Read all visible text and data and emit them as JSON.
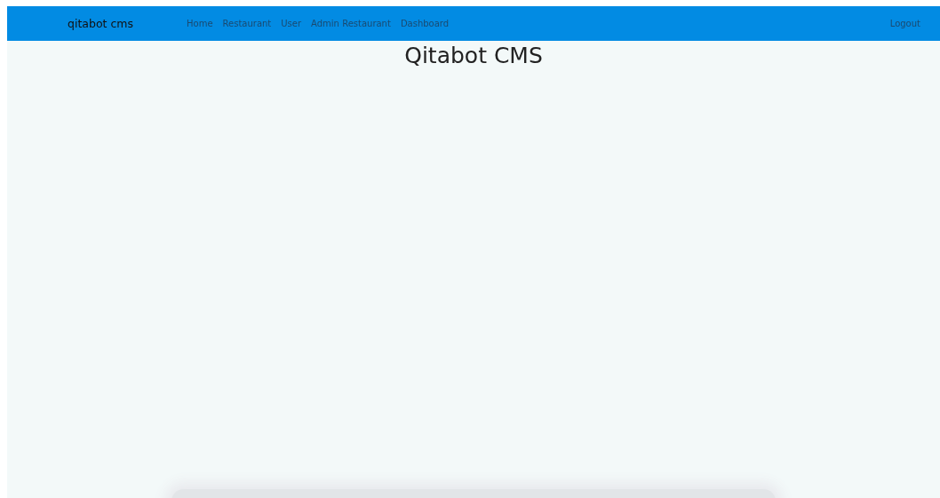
{
  "navbar": {
    "brand": "qitabot cms",
    "links": [
      {
        "label": "Home"
      },
      {
        "label": "Restaurant"
      },
      {
        "label": "User"
      },
      {
        "label": "Admin Restaurant"
      },
      {
        "label": "Dashboard"
      }
    ],
    "logout": "Logout"
  },
  "page": {
    "title": "Qitabot CMS"
  }
}
